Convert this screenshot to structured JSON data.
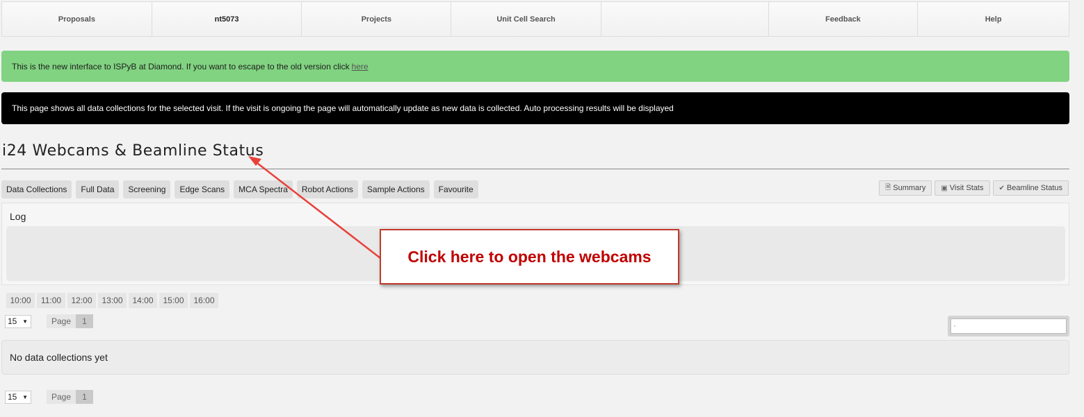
{
  "nav": {
    "items": [
      {
        "label": "Proposals",
        "current": false
      },
      {
        "label": "nt5073",
        "current": true
      },
      {
        "label": "Projects",
        "current": false
      },
      {
        "label": "Unit Cell Search",
        "current": false
      },
      {
        "label": "",
        "current": false
      },
      {
        "label": "Feedback",
        "current": false
      },
      {
        "label": "Help",
        "current": false
      }
    ]
  },
  "banners": {
    "green_text": "This is the new interface to ISPyB at Diamond. If you want to escape to the old version click",
    "green_link": "here",
    "black_text": "This page shows all data collections for the selected visit. If the visit is ongoing the page will automatically update as new data is collected. Auto processing results will be displayed"
  },
  "page": {
    "title": "i24 Webcams & Beamline Status"
  },
  "tabs": [
    "Data Collections",
    "Full Data",
    "Screening",
    "Edge Scans",
    "MCA Spectra",
    "Robot Actions",
    "Sample Actions",
    "Favourite"
  ],
  "tools": {
    "summary": "Summary",
    "visit_stats": "Visit Stats",
    "beamline_status": "Beamline Status"
  },
  "log": {
    "title": "Log"
  },
  "times": [
    "10:00",
    "11:00",
    "12:00",
    "13:00",
    "14:00",
    "15:00",
    "16:00"
  ],
  "pager": {
    "per_page": "15",
    "page_label": "Page",
    "page_number": "1"
  },
  "search": {
    "placeholder": ""
  },
  "empty_state": "No data collections yet",
  "annotation": {
    "callout_text": "Click here to open the webcams",
    "color": "#c00000"
  }
}
